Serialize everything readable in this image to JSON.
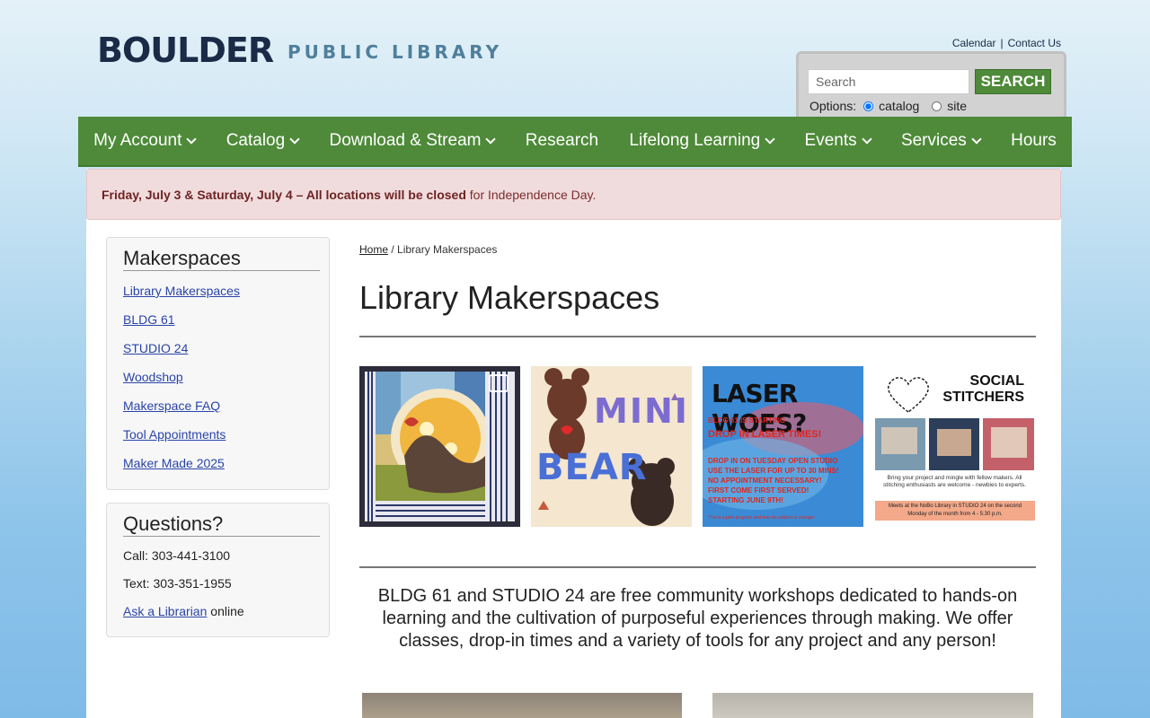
{
  "header": {
    "logo_main": "BOULDER",
    "logo_sub": "PUBLIC LIBRARY",
    "top_links": [
      "Calendar",
      "Contact Us"
    ],
    "search": {
      "placeholder": "Search",
      "button": "SEARCH",
      "options_label": "Options:",
      "option_catalog": "catalog",
      "option_site": "site",
      "selected": "catalog"
    }
  },
  "nav": [
    {
      "label": "My Account",
      "dropdown": true
    },
    {
      "label": "Catalog",
      "dropdown": true
    },
    {
      "label": "Download & Stream",
      "dropdown": true
    },
    {
      "label": "Research",
      "dropdown": false
    },
    {
      "label": "Lifelong Learning",
      "dropdown": true
    },
    {
      "label": "Events",
      "dropdown": true
    },
    {
      "label": "Services",
      "dropdown": true
    },
    {
      "label": "Hours",
      "dropdown": false
    }
  ],
  "alert": {
    "bold": "Friday, July 3 & Saturday, July 4 – All locations will be closed",
    "rest": " for Independence Day."
  },
  "sidebar": {
    "makerspaces_title": "Makerspaces",
    "links": [
      "Library Makerspaces",
      "BLDG 61",
      "STUDIO 24",
      "Woodshop",
      "Makerspace FAQ",
      "Tool Appointments",
      "Maker Made 2025"
    ],
    "questions_title": "Questions?",
    "call": "Call: 303-441-3100",
    "text": "Text: 303-351-1955",
    "ask_link": "Ask a Librarian",
    "ask_suffix": " online"
  },
  "content": {
    "breadcrumb_home": "Home",
    "breadcrumb_sep": " / ",
    "breadcrumb_current": "Library Makerspaces",
    "title": "Library Makerspaces",
    "tiles": {
      "mini_bear": {
        "line1": "MINI",
        "line2": "BEAR"
      },
      "laser": {
        "title": "LASER WOES?",
        "line1": "BLDG 61 IS STARTING",
        "line2": "DROP IN LASER TIMES!",
        "line3": "DROP IN ON TUESDAY OPEN STUDIO",
        "line4": "USE THE LASER FOR UP TO 30 MINS!",
        "line5": "NO APPOINTMENT NECESSARY!",
        "line6": "FIRST COME FIRST SERVED!",
        "line7": "STARTING JUNE 9TH!",
        "footer": "This is a pilot program and may be subject to change!"
      },
      "stitchers": {
        "title1": "SOCIAL",
        "title2": "STITCHERS",
        "body": "Bring your project and mingle with fellow makers. All stitching enthusiasts are welcome - newbies to experts.",
        "footer": "Meets at the NoBo Library in STUDIO 24 on the second Monday of the month from 4 - 5:30 p.m."
      }
    },
    "intro": "BLDG 61 and STUDIO 24 are free community workshops dedicated to hands-on learning and the cultivation of purposeful experiences through making. We offer classes, drop-in times and a variety of tools for any project and any person!"
  }
}
